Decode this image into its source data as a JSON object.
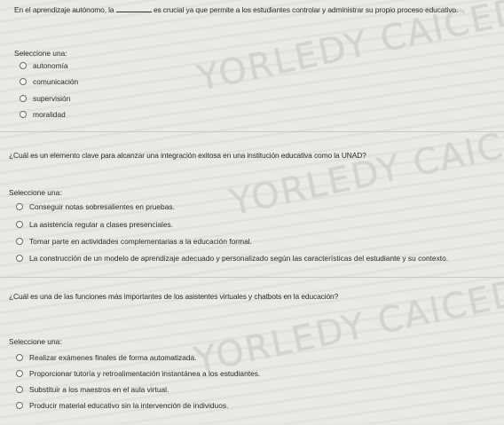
{
  "watermark": "YORLEDY CAICEDO SA",
  "questions": [
    {
      "prefix": "En el aprendizaje autónomo, la",
      "suffix": "es crucial ya que permite a los estudiantes controlar y administrar su propio proceso educativo.",
      "select_label": "Seleccione una:",
      "options": [
        "autonomía",
        "comunicación",
        "supervisión",
        "moralidad"
      ]
    },
    {
      "text": "¿Cuál es un elemento clave para alcanzar una integración exitosa en una institución educativa como la UNAD?",
      "select_label": "Seleccione una:",
      "options": [
        "Conseguir notas sobresalientes en pruebas.",
        "La asistencia regular a clases presenciales.",
        "Tomar parte en actividades complementarias a la educación formal.",
        "La construcción de un modelo de aprendizaje adecuado y personalizado según las características del estudiante y su contexto."
      ]
    },
    {
      "text": "¿Cuál es una de las funciones más importantes de los asistentes virtuales y chatbots en la educación?",
      "select_label": "Seleccione una:",
      "options": [
        "Realizar exámenes finales de forma automatizada.",
        "Proporcionar tutoría y retroalimentación instantánea a los estudiantes.",
        "Substituir a los maestros en el aula virtual.",
        "Producir material educativo sin la intervención de individuos."
      ]
    }
  ]
}
